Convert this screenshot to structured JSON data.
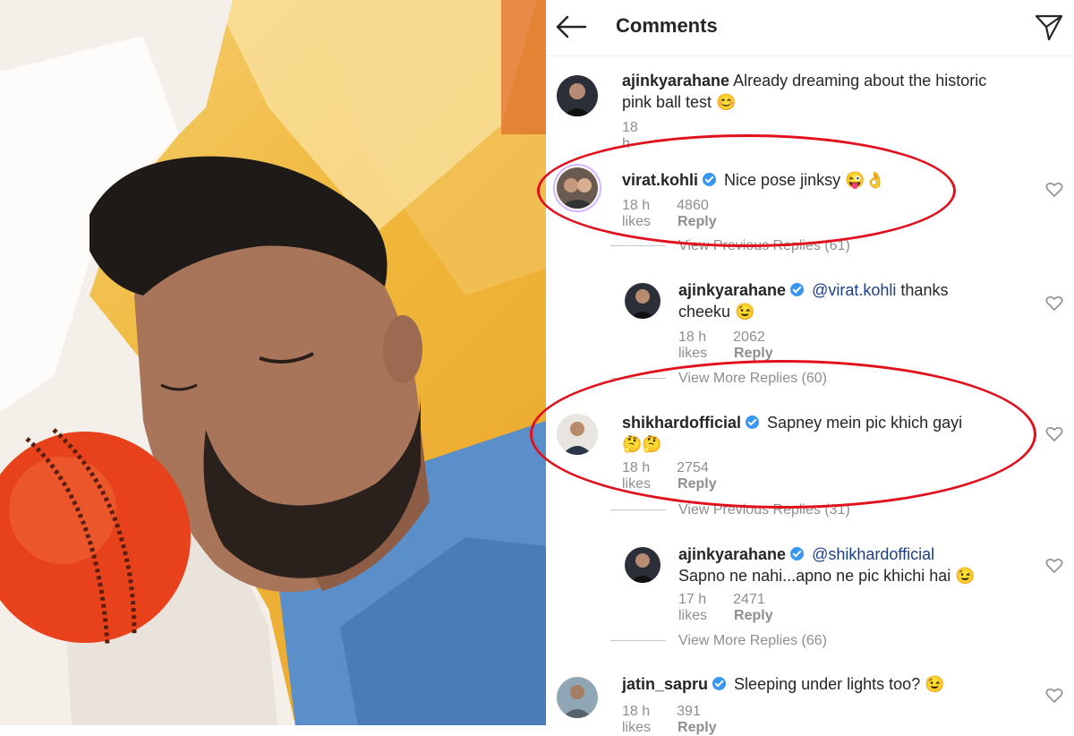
{
  "header": {
    "title": "Comments",
    "back_icon": "arrow-left-icon",
    "send_icon": "paper-plane-icon"
  },
  "comments": [
    {
      "username": "ajinkyarahane",
      "verified": false,
      "text_line1": "Already dreaming about the historic",
      "text_line2": "pink ball test",
      "emoji": "😊",
      "time": "18 h"
    },
    {
      "username": "virat.kohli",
      "verified": true,
      "text": "Nice pose jinksy",
      "emoji": "😜👌",
      "time": "18 h",
      "likes": "4860 likes",
      "reply": "Reply"
    },
    {
      "username": "ajinkyarahane",
      "verified": true,
      "mention": "@virat.kohli",
      "text_a": "thanks",
      "text_b": "cheeku",
      "emoji": "😉",
      "time": "18 h",
      "likes": "2062 likes",
      "reply": "Reply"
    },
    {
      "username": "shikhardofficial",
      "verified": true,
      "text": "Sapney mein pic khich gayi",
      "emoji": "🤔🤔",
      "time": "18 h",
      "likes": "2754 likes",
      "reply": "Reply"
    },
    {
      "username": "ajinkyarahane",
      "verified": true,
      "mention": "@shikhardofficial",
      "text": "Sapno ne nahi...apno ne pic khichi hai",
      "emoji": "😉",
      "time": "17 h",
      "likes": "2471 likes",
      "reply": "Reply"
    },
    {
      "username": "jatin_sapru",
      "verified": true,
      "text": "Sleeping under lights too?",
      "emoji": "😉",
      "time": "18 h",
      "likes": "391 likes",
      "reply": "Reply"
    }
  ],
  "threads": {
    "view_previous_1": "View Previous Replies (61)",
    "view_more_1": "View More Replies (60)",
    "view_previous_2": "View Previous Replies (31)",
    "view_more_2": "View More Replies (66)"
  },
  "colors": {
    "highlight_oval": "#e0101c",
    "verified_badge": "#3897f0",
    "mention": "#1a3f88",
    "meta_gray": "#8e8e8e"
  }
}
